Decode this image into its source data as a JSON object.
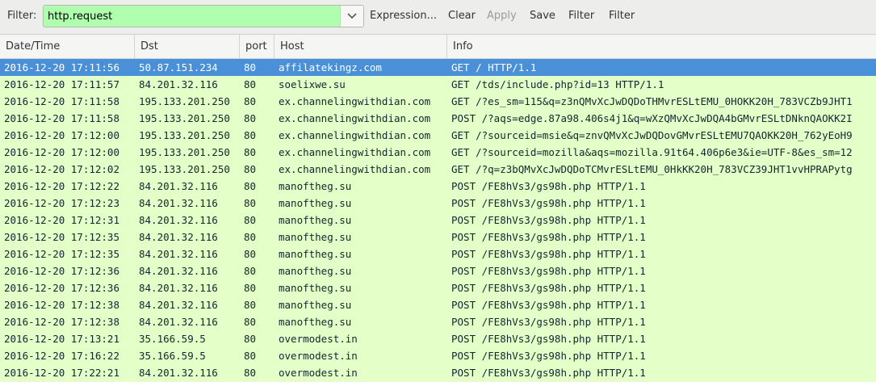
{
  "toolbar": {
    "filter_label": "Filter:",
    "filter_value": "http.request",
    "expression_label": "Expression...",
    "clear_label": "Clear",
    "apply_label": "Apply",
    "save_label": "Save",
    "filter_button_1": "Filter",
    "filter_button_2": "Filter"
  },
  "columns": [
    "Date/Time",
    "Dst",
    "port",
    "Host",
    "Info"
  ],
  "colors": {
    "filter_valid": "#afffaf",
    "row_http": "#e4ffc7",
    "row_selected": "#4a90d9"
  },
  "rows": [
    [
      "2016-12-20 17:11:56",
      "50.87.151.234",
      "80",
      "affilatekingz.com",
      "GET / HTTP/1.1"
    ],
    [
      "2016-12-20 17:11:57",
      "84.201.32.116",
      "80",
      "soelixwe.su",
      "GET /tds/include.php?id=13 HTTP/1.1"
    ],
    [
      "2016-12-20 17:11:58",
      "195.133.201.250",
      "80",
      "ex.channelingwithdian.com",
      "GET /?es_sm=115&q=z3nQMvXcJwDQDoTHMvrESLtEMU_0HOKK20H_783VCZb9JHT1"
    ],
    [
      "2016-12-20 17:11:58",
      "195.133.201.250",
      "80",
      "ex.channelingwithdian.com",
      "POST /?aqs=edge.87a98.406s4j1&q=wXzQMvXcJwDQA4bGMvrESLtDNknQAOKK2I"
    ],
    [
      "2016-12-20 17:12:00",
      "195.133.201.250",
      "80",
      "ex.channelingwithdian.com",
      "GET /?sourceid=msie&q=znvQMvXcJwDQDovGMvrESLtEMU7QAOKK20H_762yEoH9"
    ],
    [
      "2016-12-20 17:12:00",
      "195.133.201.250",
      "80",
      "ex.channelingwithdian.com",
      "GET /?sourceid=mozilla&aqs=mozilla.91t64.406p6e3&ie=UTF-8&es_sm=12"
    ],
    [
      "2016-12-20 17:12:02",
      "195.133.201.250",
      "80",
      "ex.channelingwithdian.com",
      "GET /?q=z3bQMvXcJwDQDoTCMvrESLtEMU_0HkKK20H_783VCZ39JHT1vvHPRAPytg"
    ],
    [
      "2016-12-20 17:12:22",
      "84.201.32.116",
      "80",
      "manoftheg.su",
      "POST /FE8hVs3/gs98h.php HTTP/1.1"
    ],
    [
      "2016-12-20 17:12:23",
      "84.201.32.116",
      "80",
      "manoftheg.su",
      "POST /FE8hVs3/gs98h.php HTTP/1.1"
    ],
    [
      "2016-12-20 17:12:31",
      "84.201.32.116",
      "80",
      "manoftheg.su",
      "POST /FE8hVs3/gs98h.php HTTP/1.1"
    ],
    [
      "2016-12-20 17:12:35",
      "84.201.32.116",
      "80",
      "manoftheg.su",
      "POST /FE8hVs3/gs98h.php HTTP/1.1"
    ],
    [
      "2016-12-20 17:12:35",
      "84.201.32.116",
      "80",
      "manoftheg.su",
      "POST /FE8hVs3/gs98h.php HTTP/1.1"
    ],
    [
      "2016-12-20 17:12:36",
      "84.201.32.116",
      "80",
      "manoftheg.su",
      "POST /FE8hVs3/gs98h.php HTTP/1.1"
    ],
    [
      "2016-12-20 17:12:36",
      "84.201.32.116",
      "80",
      "manoftheg.su",
      "POST /FE8hVs3/gs98h.php HTTP/1.1"
    ],
    [
      "2016-12-20 17:12:38",
      "84.201.32.116",
      "80",
      "manoftheg.su",
      "POST /FE8hVs3/gs98h.php HTTP/1.1"
    ],
    [
      "2016-12-20 17:12:38",
      "84.201.32.116",
      "80",
      "manoftheg.su",
      "POST /FE8hVs3/gs98h.php HTTP/1.1"
    ],
    [
      "2016-12-20 17:13:21",
      "35.166.59.5",
      "80",
      "overmodest.in",
      "POST /FE8hVs3/gs98h.php HTTP/1.1"
    ],
    [
      "2016-12-20 17:16:22",
      "35.166.59.5",
      "80",
      "overmodest.in",
      "POST /FE8hVs3/gs98h.php HTTP/1.1"
    ],
    [
      "2016-12-20 17:22:21",
      "84.201.32.116",
      "80",
      "overmodest.in",
      "POST /FE8hVs3/gs98h.php HTTP/1.1"
    ]
  ],
  "selected_row": 0
}
